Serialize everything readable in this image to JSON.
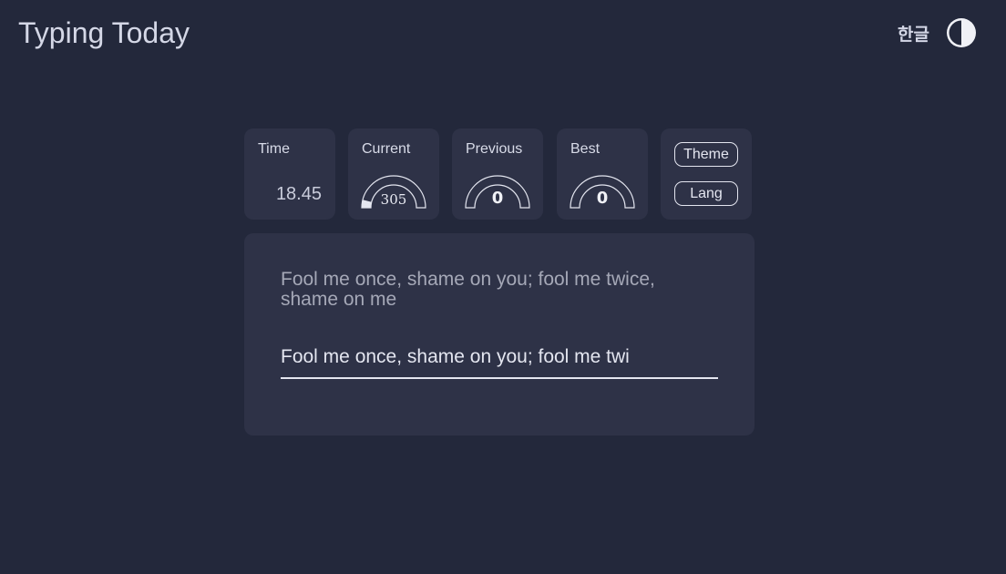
{
  "header": {
    "title": "Typing Today",
    "lang_toggle": "한글",
    "theme_icon": "half-circle-contrast-icon"
  },
  "stats": {
    "time": {
      "label": "Time",
      "value": "18.45"
    },
    "current": {
      "label": "Current",
      "value": "305",
      "gauge_fill": 0.08
    },
    "previous": {
      "label": "Previous",
      "value": "0",
      "gauge_fill": 0
    },
    "best": {
      "label": "Best",
      "value": "0",
      "gauge_fill": 0
    }
  },
  "controls": {
    "theme_label": "Theme",
    "lang_label": "Lang"
  },
  "typing": {
    "prompt": "Fool me once, shame on you; fool me twice, shame on me",
    "input_value": "Fool me once, shame on you; fool me twi"
  },
  "colors": {
    "background": "#23283b",
    "card": "#2e3247",
    "text": "#d8dbe8",
    "prompt_text": "#a5a8b7",
    "gauge_stroke": "#e4e6f0"
  }
}
